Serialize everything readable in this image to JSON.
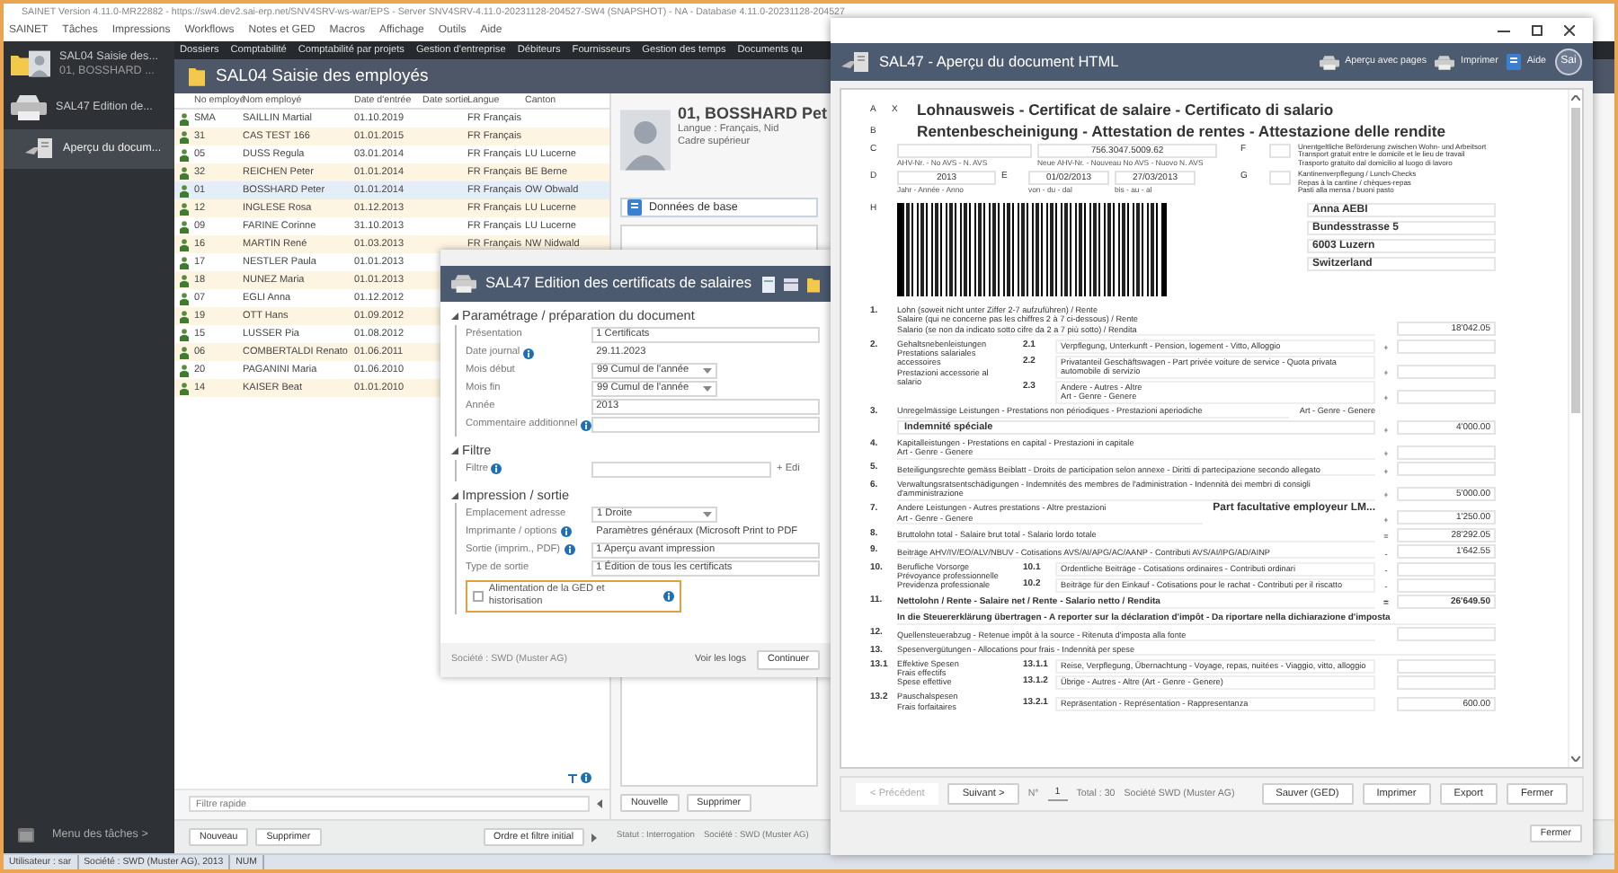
{
  "window": {
    "title": "SAINET Version 4.11.0-MR22882 - https://sw4.dev2.sai-erp.net/SNV4SRV-ws-war/EPS - Server SNV4SRV-4.11.0-20231128-204527-SW4 (SNAPSHOT) - NA - Database 4.11.0-20231128-204527"
  },
  "menu": [
    "SAINET",
    "Tâches",
    "Impressions",
    "Workflows",
    "Notes et GED",
    "Macros",
    "Affichage",
    "Outils",
    "Aide"
  ],
  "sidebar": {
    "items": [
      {
        "kind": "folder",
        "title": "SAL04 Saisie des...",
        "subtitle": "01, BOSSHARD ...",
        "selected": false
      },
      {
        "kind": "printer",
        "title": "SAL47 Edition de...",
        "selected": false,
        "children": [
          {
            "kind": "preview",
            "title": "Aperçu du docum...",
            "selected": true
          }
        ]
      }
    ],
    "footer": "Menu des tâches >"
  },
  "nav": [
    "Dossiers",
    "Comptabilité",
    "Comptabilité par projets",
    "Gestion d'entreprise",
    "Débiteurs",
    "Fournisseurs",
    "Gestion des temps",
    "Documents qu"
  ],
  "module": {
    "title": "SAL04 Saisie des employés"
  },
  "table": {
    "columns": [
      "No employé",
      "Nom employé",
      "Date d'entrée",
      "Date sortie",
      "Langue",
      "Canton"
    ],
    "rows": [
      {
        "no": "SMA",
        "name": "SAILLIN Martial",
        "entry": "01.10.2019",
        "language": "FR Français",
        "selected": false
      },
      {
        "no": "31",
        "name": "CAS TEST 166",
        "entry": "01.01.2015",
        "language": "FR Français",
        "selected": false
      },
      {
        "no": "05",
        "name": "DUSS Regula",
        "entry": "03.01.2014",
        "language": "FR Français",
        "canton": "LU Lucerne",
        "selected": false
      },
      {
        "no": "32",
        "name": "REICHEN Peter",
        "entry": "01.01.2014",
        "language": "FR Français",
        "canton": "BE Berne",
        "selected": false
      },
      {
        "no": "01",
        "name": "BOSSHARD Peter",
        "entry": "01.01.2014",
        "language": "FR Français",
        "canton": "OW Obwald",
        "selected": true
      },
      {
        "no": "12",
        "name": "INGLESE Rosa",
        "entry": "01.12.2013",
        "language": "FR Français",
        "canton": "LU Lucerne",
        "selected": false
      },
      {
        "no": "09",
        "name": "FARINE Corinne",
        "entry": "31.10.2013",
        "language": "FR Français",
        "canton": "LU Lucerne",
        "selected": false
      },
      {
        "no": "16",
        "name": "MARTIN René",
        "entry": "01.03.2013",
        "language": "FR Français",
        "canton": "NW Nidwald",
        "selected": false
      },
      {
        "no": "17",
        "name": "NESTLER Paula",
        "entry": "01.01.2013",
        "selected": false
      },
      {
        "no": "18",
        "name": "NUNEZ Maria",
        "entry": "01.01.2013",
        "selected": false
      },
      {
        "no": "07",
        "name": "EGLI Anna",
        "entry": "01.12.2012",
        "selected": false
      },
      {
        "no": "19",
        "name": "OTT Hans",
        "entry": "01.09.2012",
        "selected": false
      },
      {
        "no": "15",
        "name": "LUSSER Pia",
        "entry": "01.08.2012",
        "selected": false
      },
      {
        "no": "06",
        "name": "COMBERTALDI Renato",
        "entry": "01.06.2011",
        "selected": false
      },
      {
        "no": "20",
        "name": "PAGANINI Maria",
        "entry": "01.06.2010",
        "selected": false
      },
      {
        "no": "14",
        "name": "KAISER Beat",
        "entry": "01.01.2010",
        "selected": false
      }
    ],
    "filter_placeholder": "Filtre rapide",
    "buttons": [
      "Nouveau",
      "Supprimer"
    ],
    "order_button": "Ordre et filtre initial"
  },
  "detail": {
    "name": "01, BOSSHARD Pet",
    "lines": [
      "Langue : Français, Nid",
      "Cadre supérieur"
    ],
    "tab": "Données de base",
    "buttons": [
      "Nouvelle",
      "Supprimer"
    ],
    "status": "Statut : Interrogation",
    "company": "Société : SWD (Muster AG)"
  },
  "dialog": {
    "title": "SAL47 Edition des certificats de salaires",
    "sections": [
      {
        "title": "Paramétrage / préparation du document",
        "fields": [
          {
            "label": "Présentation",
            "info": false,
            "kind": "text",
            "value": "1 Certificats"
          },
          {
            "label": "Date journal",
            "info": true,
            "kind": "plain",
            "value": "29.11.2023"
          },
          {
            "label": "Mois début",
            "info": false,
            "kind": "select",
            "value": "99 Cumul de l'année"
          },
          {
            "label": "Mois fin",
            "info": false,
            "kind": "select",
            "value": "99 Cumul de l'année"
          },
          {
            "label": "Année",
            "info": false,
            "kind": "text",
            "value": "2013"
          },
          {
            "label": "Commentaire additionnel",
            "info": true,
            "kind": "text"
          }
        ]
      },
      {
        "title": "Filtre",
        "fields": [
          {
            "label": "Filtre",
            "info": true,
            "kind": "text",
            "link": "+ Edi"
          }
        ]
      },
      {
        "title": "Impression / sortie",
        "fields": [
          {
            "label": "Emplacement adresse",
            "info": false,
            "kind": "select",
            "value": "1 Droite"
          },
          {
            "label": "Imprimante / options",
            "info": true,
            "kind": "plain",
            "value": "Paramètres généraux (Microsoft Print to PDF"
          },
          {
            "label": "Sortie (imprim., PDF)",
            "info": true,
            "kind": "text",
            "value": "1 Aperçu avant impression"
          },
          {
            "label": "Type de sortie",
            "info": false,
            "kind": "text",
            "value": "1 Édition de tous les certificats"
          }
        ],
        "checkbox": {
          "label": "Alimentation de la GED et historisation",
          "info": true,
          "checked": false,
          "highlighted": true
        }
      }
    ],
    "company": "Société : SWD (Muster AG)",
    "logs_link": "Voir les logs",
    "continue_button": "Continuer"
  },
  "preview": {
    "title": "SAL47 - Aperçu du document HTML",
    "toolbar": [
      {
        "kind": "printer",
        "label": "Aperçu avec pages"
      },
      {
        "kind": "printer",
        "label": "Imprimer"
      },
      {
        "kind": "help",
        "label": "Aide"
      }
    ],
    "logo": "Sai",
    "document": {
      "titles": [
        {
          "letter": "A",
          "mark": "X",
          "text": "Lohnausweis - Certificat de salaire - Certificato di salario"
        },
        {
          "letter": "B",
          "text": "Rentenbescheinigung - Attestation de rentes - Attestazione delle rendite"
        }
      ],
      "row_c": {
        "letter": "C",
        "new_avs": "756.3047.5009.62",
        "caption_old": "AHV-Nr. - No AVS - N. AVS",
        "caption_new": "Neue AHV-Nr. - Nouveau No AVS - Nuovo N. AVS",
        "side_letter": "F",
        "side_text": [
          "Unentgeltliche Beförderung zwischen Wohn- und Arbeitsort",
          "Transport gratuit entre le domicile et le lieu de travail",
          "Trasporto gratuito dal domicilio al luogo di lavoro"
        ]
      },
      "row_d": {
        "letter": "D",
        "year": "2013",
        "year_caption": "Jahr - Année - Anno",
        "period_letter": "E",
        "from": "01/02/2013",
        "from_caption": "von - du - dal",
        "to": "27/03/2013",
        "to_caption": "bis - au - al",
        "side_letter": "G",
        "side_text": [
          "Kantinenverpflegung / Lunch-Checks",
          "Repas à la cantine / chèques-repas",
          "Pasti alla mensa / buoni pasto"
        ]
      },
      "letter_h": "H",
      "address": [
        "Anna AEBI",
        "Bundesstrasse 5",
        "6003 Luzern",
        "Switzerland"
      ],
      "lines": [
        {
          "num": "1.",
          "label": [
            "Lohn (soweit nicht unter Ziffer 2-7 aufzuführen) / Rente",
            "Salaire (qui ne concerne pas les chiffres 2 à 7 ci-dessous) / Rente",
            "Salario (se non da indicato sotto cifre da 2 a 7 più sotto) / Rendita"
          ],
          "amount": "18'042.05",
          "bold": false
        },
        {
          "num": "2.",
          "label": [
            "Gehaltsnebenleistungen",
            "Prestations salariales",
            "accessoires",
            "Prestazioni accessorie al",
            "salario"
          ],
          "bold": false,
          "subs": [
            {
              "num": "2.1",
              "label": [
                "Verpflegung, Unterkunft - Pension, logement - Vitto, Alloggio"
              ],
              "sign": "+"
            },
            {
              "num": "2.2",
              "label": [
                "Privatanteil Geschäftswagen - Part privée voiture de service - Quota privata automobile di servizio"
              ],
              "sign": "+"
            },
            {
              "num": "2.3",
              "label": [
                "Andere - Autres - Altre",
                "Art - Genre - Genere"
              ],
              "sign": "+"
            }
          ]
        },
        {
          "num": "3.",
          "label": [
            "Unregelmässige Leistungen - Prestations non périodiques - Prestazioni aperiodiche"
          ],
          "aside": "Art - Genre - Genere",
          "detail": "Indemnité spéciale",
          "sign": "+",
          "amount": "4'000.00",
          "bold": false
        },
        {
          "num": "4.",
          "label": [
            "Kapitalleistungen - Prestations en capital - Prestazioni in capitale",
            "Art - Genre - Genere"
          ],
          "sign": "+",
          "bold": false
        },
        {
          "num": "5.",
          "label": [
            "Beteiligungsrechte gemäss Beiblatt - Droits de participation selon annexe - Diritti di partecipazione secondo allegato"
          ],
          "sign": "+",
          "bold": false
        },
        {
          "num": "6.",
          "label": [
            "Verwaltungsratsentschädigungen - Indemnités des membres de l'administration - Indennità dei membri di consigli d'amministrazione"
          ],
          "sign": "+",
          "amount": "5'000.00",
          "bold": false
        },
        {
          "num": "7.",
          "label": [
            "Andere Leistungen - Autres prestations - Altre prestazioni",
            "Art - Genre - Genere"
          ],
          "aside": "Part facultative employeur LM...",
          "sign": "+",
          "amount": "1'250.00",
          "bold": false
        },
        {
          "num": "8.",
          "label": [
            "Bruttolohn total - Salaire brut total - Salario lordo totale"
          ],
          "sign": "=",
          "amount": "28'292.05",
          "bold": false
        },
        {
          "num": "9.",
          "label": [
            "Beiträge AHV/IV/EO/ALV/NBUV - Cotisations AVS/AI/APG/AC/AANP - Contributi AVS/AI/IPG/AD/AINP"
          ],
          "sign": "-",
          "amount": "1'642.55",
          "bold": false
        },
        {
          "num": "10.",
          "label": [
            "Berufliche Vorsorge",
            "Prévoyance professionnelle",
            "Previdenza professionale"
          ],
          "bold": false,
          "subs": [
            {
              "num": "10.1",
              "label": [
                "Ordentliche Beiträge - Cotisations ordinaires - Contributi ordinari"
              ],
              "sign": "-"
            },
            {
              "num": "10.2",
              "label": [
                "Beiträge für den Einkauf - Cotisations pour le rachat - Contributi per il riscatto"
              ],
              "sign": "-"
            }
          ]
        },
        {
          "num": "11.",
          "label": [
            "Nettolohn / Rente - Salaire net / Rente - Salario netto / Rendita"
          ],
          "sign": "=",
          "amount": "26'649.50",
          "bold": true
        },
        {
          "label": [
            "In die Steuererklärung übertragen - A reporter sur la déclaration d'impôt - Da riportare nella dichiarazione d'imposta"
          ],
          "bold": true
        },
        {
          "num": "12.",
          "label": [
            "Quellensteuerabzug - Retenue impôt à la source - Ritenuta d'imposta alla fonte"
          ],
          "bold": false,
          "box": true
        },
        {
          "num": "13.",
          "label": [
            "Spesenvergütungen - Allocations pour frais - Indennità per spese"
          ],
          "bold": false
        },
        {
          "num": "13.1",
          "label": [
            "Effektive Spesen",
            "Frais effectifs",
            "Spese effettive"
          ],
          "bold": false,
          "subs": [
            {
              "num": "13.1.1",
              "label": [
                "Reise, Verpflegung, Übernachtung - Voyage, repas, nuitées - Viaggio, vitto, alloggio"
              ]
            },
            {
              "num": "13.1.2",
              "label": [
                "Übrige - Autres - Altre  (Art - Genre - Genere)"
              ]
            }
          ]
        },
        {
          "num": "13.2",
          "label": [
            "Pauschalspesen",
            "Frais forfaitaires"
          ],
          "bold": false,
          "subs": [
            {
              "num": "13.2.1",
              "label": [
                "Repräsentation - Représentation - Rappresentanza"
              ],
              "amount": "600.00"
            }
          ]
        }
      ]
    },
    "pager": {
      "previous": {
        "label": "< Précédent",
        "disabled": true
      },
      "next": {
        "label": "Suivant >",
        "disabled": false
      },
      "number_label": "N°",
      "number": "1",
      "total": "Total : 30",
      "company": "Société SWD (Muster AG)"
    },
    "actions": [
      "Sauver (GED)",
      "Imprimer",
      "Export",
      "Fermer"
    ],
    "close_button": "Fermer"
  },
  "status_bar": [
    "Utilisateur : sar",
    "Société : SWD (Muster AG), 2013",
    "NUM"
  ]
}
